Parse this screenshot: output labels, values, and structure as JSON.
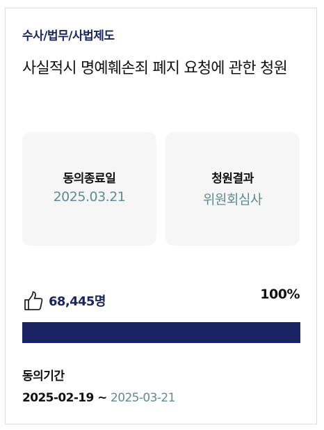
{
  "petition": {
    "category": "수사/법무/사법제도",
    "title": "사실적시 명예훼손죄 폐지 요청에 관한 청원"
  },
  "info": {
    "end_date_label": "동의종료일",
    "end_date_value": "2025.03.21",
    "result_label": "청원결과",
    "result_value": "위원회심사"
  },
  "agreement": {
    "icon": "thumbs-up-icon",
    "count": "68,445명",
    "percent_label": "100%",
    "progress_fraction": 1.0
  },
  "period": {
    "label": "동의기간",
    "start": "2025-02-19",
    "separator": " ~ ",
    "end": "2025-03-21"
  },
  "colors": {
    "accent_navy": "#1b2262",
    "accent_teal": "#5e8c8a",
    "box_bg": "#f6f6f6"
  }
}
